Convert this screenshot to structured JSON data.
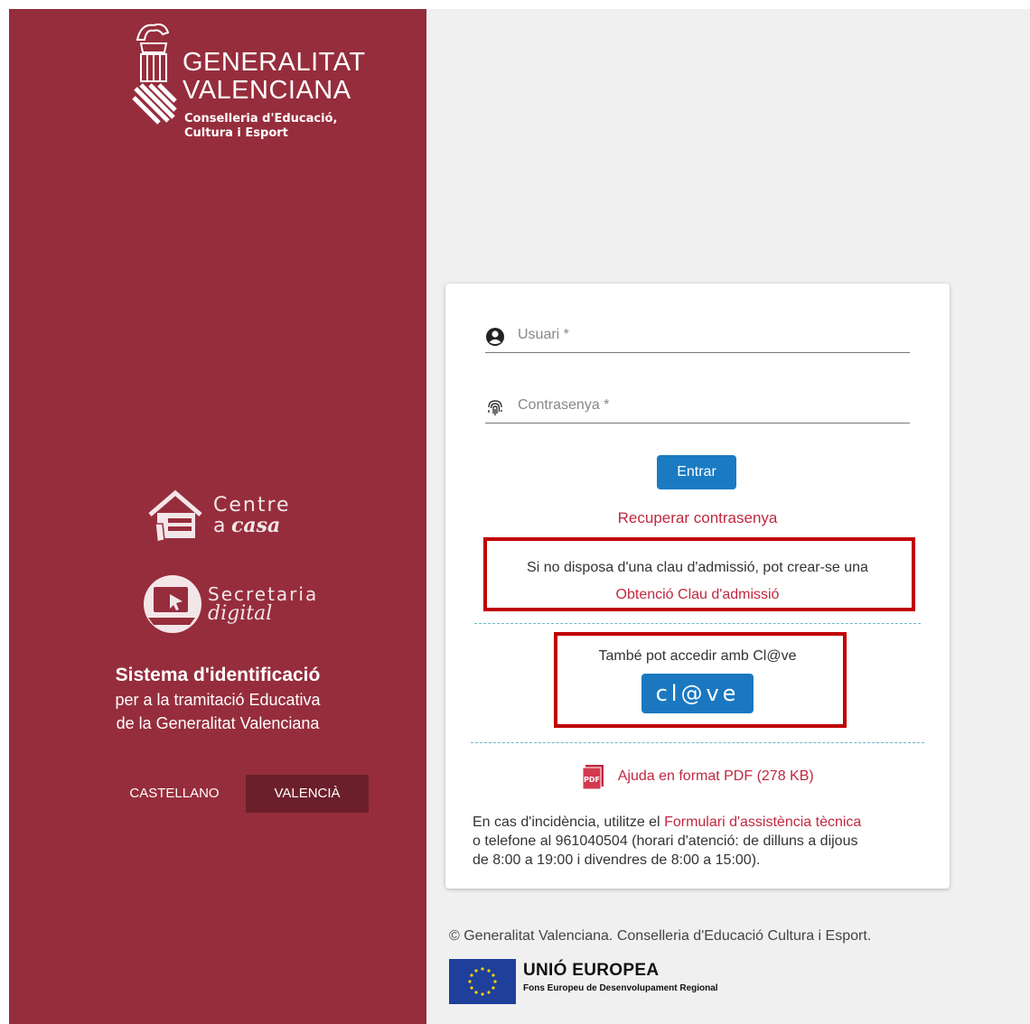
{
  "brand": {
    "name_line1": "GENERALITAT",
    "name_line2": "VALENCIANA",
    "dept_line1": "Conselleria d'Educació,",
    "dept_line2": "Cultura i Esport"
  },
  "apps": {
    "centre_word1": "Centre",
    "centre_word2a": "a",
    "centre_word2b": "casa",
    "secretaria_word1": "Secretaria",
    "secretaria_word2": "digital"
  },
  "system": {
    "title": "Sistema d'identificació",
    "subtitle_line1": "per a la tramitació Educativa",
    "subtitle_line2": "de la Generalitat Valenciana"
  },
  "language": {
    "castellano": "CASTELLANO",
    "valencia": "VALENCIÀ",
    "selected": "VALENCIÀ"
  },
  "login": {
    "user_placeholder": "Usuari *",
    "user_value": "",
    "password_placeholder": "Contrasenya *",
    "password_value": "",
    "submit": "Entrar",
    "recover": "Recuperar contrasenya"
  },
  "admission": {
    "text": "Si no disposa d'una clau d'admissió, pot crear-se una",
    "link": "Obtenció Clau d'admissió"
  },
  "clave": {
    "text": "També pot accedir amb Cl@ve",
    "button": "cl@ve"
  },
  "help_pdf": {
    "link": "Ajuda en format PDF (278 KB)"
  },
  "support": {
    "prefix": "En cas d'incidència, utilitze el ",
    "form_link": "Formulari d'assistència tècnica",
    "line2": "o telefone al 961040504 (horari d'atenció: de dilluns a dijous",
    "line3": "de 8:00 a 19:00 i divendres de 8:00 a 15:00)."
  },
  "footer": {
    "copyright": "© Generalitat Valenciana. Conselleria d'Educació Cultura i Esport.",
    "eu_title": "UNIÓ EUROPEA",
    "eu_subtitle": "Fons Europeu de Desenvolupament Regional"
  },
  "colors": {
    "sidebar": "#962d3c",
    "accent_link": "#c0283f",
    "primary_button": "#1a7bc2",
    "highlight_box": "#c00000"
  }
}
